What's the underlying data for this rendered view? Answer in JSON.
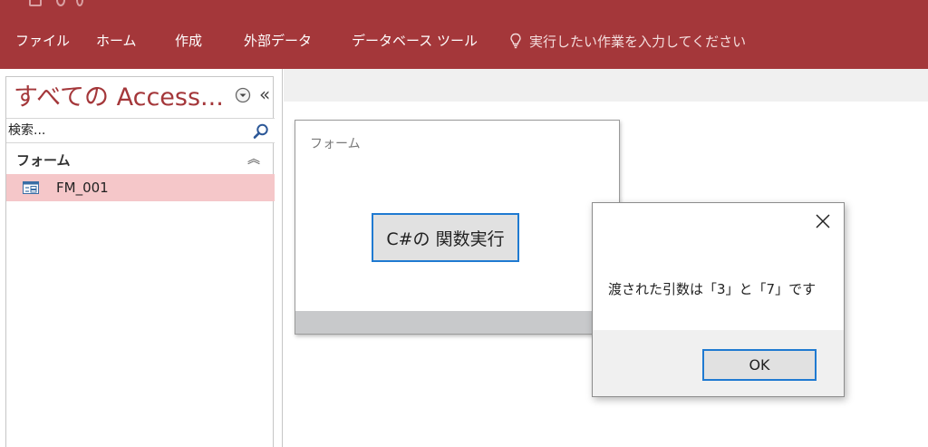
{
  "ribbon": {
    "tabs": [
      "ファイル",
      "ホーム",
      "作成",
      "外部データ",
      "データベース ツール"
    ],
    "tell_me": "実行したい作業を入力してください",
    "color": "#a4373a"
  },
  "nav_pane": {
    "title": "すべての Access...",
    "search_placeholder": "検索...",
    "group_label": "フォーム",
    "items": [
      {
        "label": "FM_001",
        "icon": "form-icon",
        "selected": true
      }
    ],
    "selected_color": "#f5c7c9"
  },
  "form": {
    "caption": "フォーム",
    "button_label": "C#の 関数実行"
  },
  "message_box": {
    "text": "渡された引数は「3」と「7」です",
    "ok_label": "OK",
    "focus_color": "#1f7ad1"
  }
}
